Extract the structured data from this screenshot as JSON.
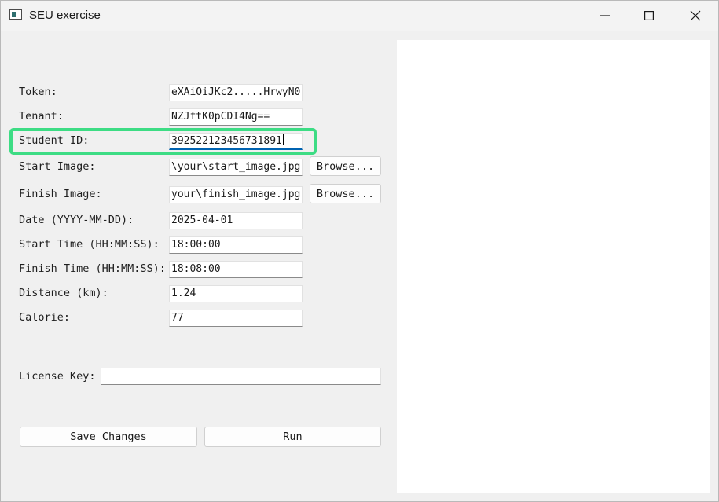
{
  "window": {
    "title": "SEU exercise"
  },
  "form": {
    "token": {
      "label": "Token:",
      "value": "eXAiOiJKc2.....HrwyN0"
    },
    "tenant": {
      "label": "Tenant:",
      "value": "NZJftK0pCDI4Ng=="
    },
    "student_id": {
      "label": "Student ID:",
      "value": "392522123456731891"
    },
    "start_image": {
      "label": "Start Image:",
      "value": "\\your\\start_image.jpg",
      "browse_label": "Browse..."
    },
    "finish_image": {
      "label": "Finish Image:",
      "value": "your\\finish_image.jpg",
      "browse_label": "Browse..."
    },
    "date": {
      "label": "Date (YYYY-MM-DD):",
      "value": "2025-04-01"
    },
    "start_time": {
      "label": "Start Time (HH:MM:SS):",
      "value": "18:00:00"
    },
    "finish_time": {
      "label": "Finish Time (HH:MM:SS):",
      "value": "18:08:00"
    },
    "distance": {
      "label": "Distance (km):",
      "value": "1.24"
    },
    "calorie": {
      "label": "Calorie:",
      "value": "77"
    },
    "license_key": {
      "label": "License Key:",
      "value": ""
    }
  },
  "actions": {
    "save_label": "Save Changes",
    "run_label": "Run"
  },
  "colors": {
    "highlight": "#3ddc84",
    "focus": "#0063b1"
  }
}
